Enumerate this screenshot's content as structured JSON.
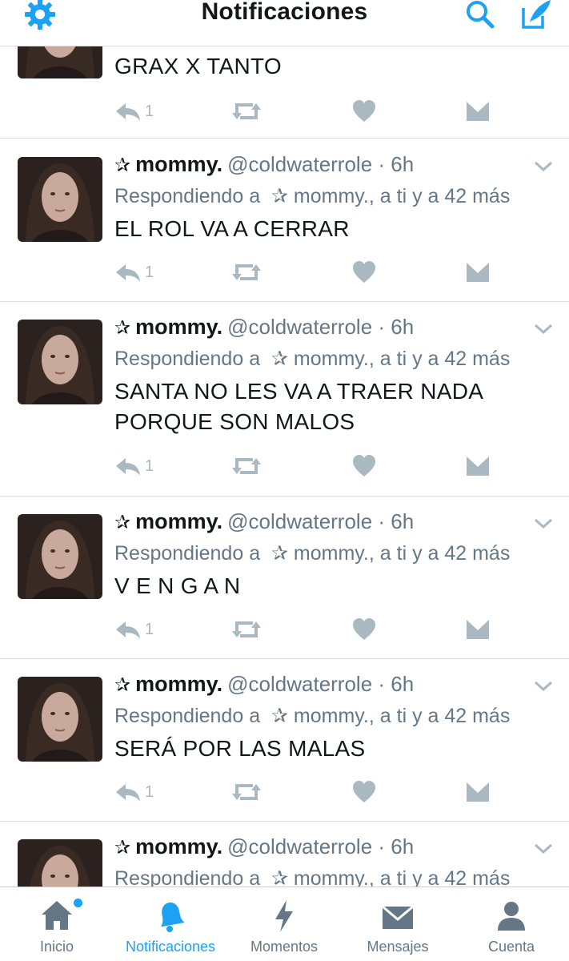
{
  "header": {
    "title": "Notificaciones",
    "accent_color": "#1da1f2",
    "icons": [
      "gear-icon",
      "search-icon",
      "compose-icon"
    ]
  },
  "feed": {
    "tweets": [
      {
        "partial": true,
        "text": "GRAX X TANTO",
        "reply_count": "1"
      },
      {
        "star": "✰",
        "name": "mommy.",
        "handle": "@coldwaterrole · 6h",
        "replying_prefix": "Respondiendo a",
        "replying_star": "✰",
        "replying_rest": "mommy., a ti y a 42 más",
        "text": "EL ROL VA A CERRAR",
        "reply_count": "1"
      },
      {
        "star": "✰",
        "name": "mommy.",
        "handle": "@coldwaterrole · 6h",
        "replying_prefix": "Respondiendo a",
        "replying_star": "✰",
        "replying_rest": "mommy., a ti y a 42 más",
        "text": "SANTA NO LES VA A TRAER NADA\nPORQUE SON MALOS",
        "reply_count": "1"
      },
      {
        "star": "✰",
        "name": "mommy.",
        "handle": "@coldwaterrole · 6h",
        "replying_prefix": "Respondiendo a",
        "replying_star": "✰",
        "replying_rest": "mommy., a ti y a 42 más",
        "text": "V E N G A N",
        "reply_count": "1"
      },
      {
        "star": "✰",
        "name": "mommy.",
        "handle": "@coldwaterrole · 6h",
        "replying_prefix": "Respondiendo a",
        "replying_star": "✰",
        "replying_rest": "mommy., a ti y a 42 más",
        "text": "SERÁ POR LAS MALAS",
        "reply_count": "1"
      },
      {
        "star": "✰",
        "name": "mommy.",
        "handle": "@coldwaterrole · 6h",
        "replying_prefix": "Respondiendo a",
        "replying_star": "✰",
        "replying_rest": "mommy., a ti y a 42 más",
        "partial": true
      }
    ]
  },
  "tabbar": {
    "tabs": [
      {
        "label": "Inicio",
        "icon": "home-icon",
        "badge": true
      },
      {
        "label": "Notificaciones",
        "icon": "bell-icon",
        "active": true
      },
      {
        "label": "Momentos",
        "icon": "lightning-icon"
      },
      {
        "label": "Mensajes",
        "icon": "envelope-icon"
      },
      {
        "label": "Cuenta",
        "icon": "person-icon"
      }
    ]
  }
}
